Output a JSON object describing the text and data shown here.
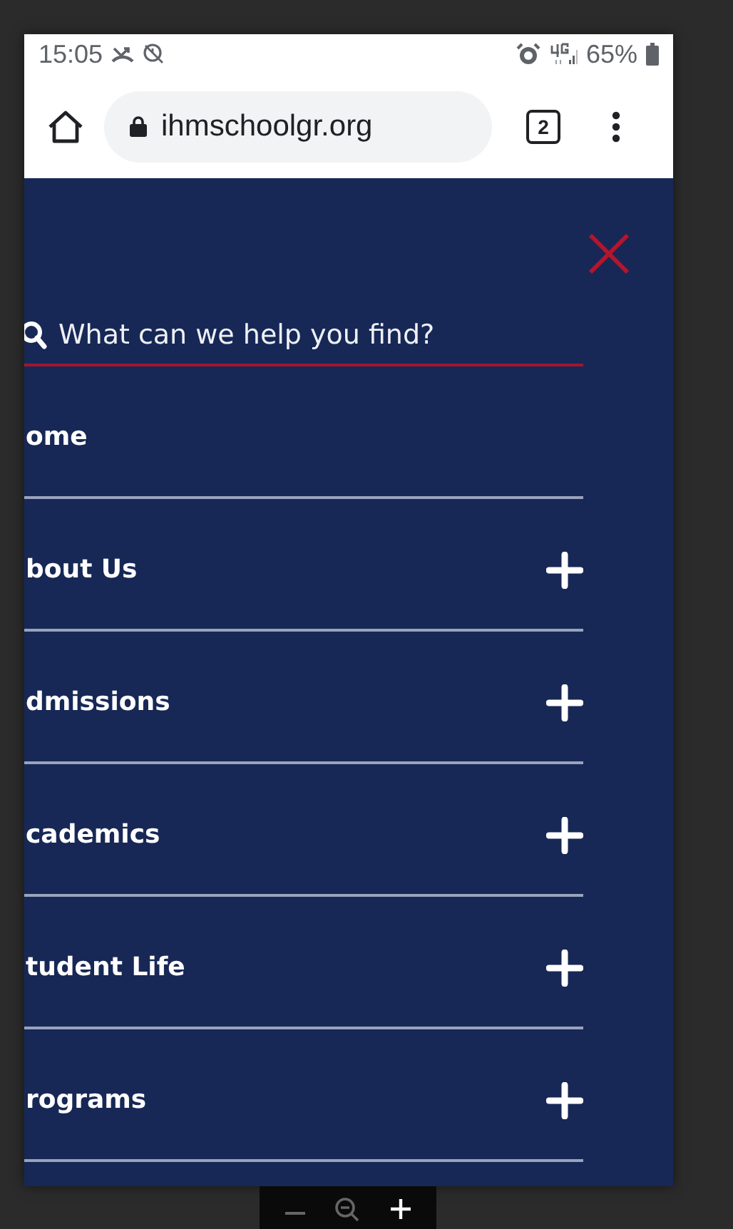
{
  "status_bar": {
    "time": "15:05",
    "battery": "65%"
  },
  "browser": {
    "url": "ihmschoolgr.org",
    "tab_count": "2"
  },
  "menu": {
    "search": {
      "placeholder": "What can we help you find?"
    },
    "items": [
      {
        "label": "ome",
        "expandable": false
      },
      {
        "label": "bout Us",
        "expandable": true
      },
      {
        "label": "dmissions",
        "expandable": true
      },
      {
        "label": "cademics",
        "expandable": true
      },
      {
        "label": "tudent Life",
        "expandable": true
      },
      {
        "label": "rograms",
        "expandable": true
      }
    ]
  }
}
